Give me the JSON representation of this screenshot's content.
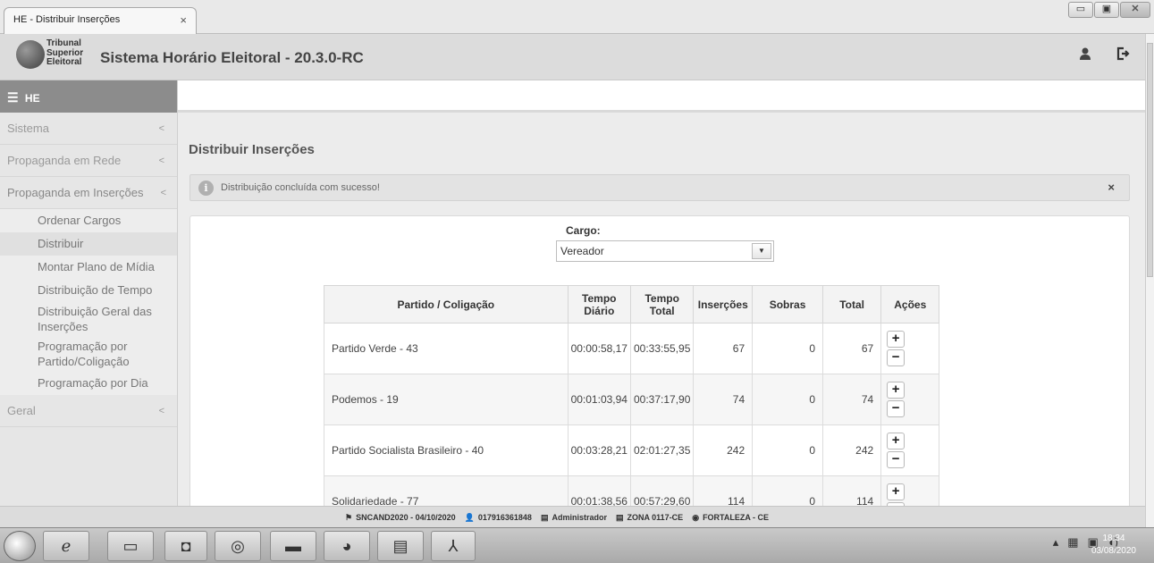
{
  "browser": {
    "tab_title": "HE - Distribuir Inserções",
    "tab_close": "×",
    "window_buttons": [
      "▭",
      "▣",
      "✕"
    ]
  },
  "header": {
    "logo_lines": [
      "Tribunal",
      "Superior",
      "Eleitoral"
    ],
    "title": "Sistema Horário Eleitoral - 20.3.0-RC",
    "user_icon": "user-icon",
    "logout_icon": "logout-icon"
  },
  "sidebar": {
    "toggle_label": "HE",
    "menu": [
      {
        "label": "Sistema",
        "chevron": "<"
      },
      {
        "label": "Propaganda em Rede",
        "chevron": "<"
      },
      {
        "label": "Propaganda em Inserções",
        "chevron": "<"
      }
    ],
    "submenu": [
      "Ordenar Cargos",
      "Distribuir",
      "Montar Plano de Mídia",
      "Distribuição de Tempo",
      "Distribuição Geral das Inserções",
      "Programação por Partido/Coligação",
      "Programação por Dia"
    ],
    "bottom_item": {
      "label": "Geral",
      "chevron": "<"
    }
  },
  "main": {
    "page_title": "Distribuir Inserções",
    "alert": {
      "message": "Distribuição concluída com sucesso!",
      "close": "×"
    },
    "cargo": {
      "label": "Cargo:",
      "value": "Vereador"
    },
    "table": {
      "headers": [
        "Partido / Coligação",
        "Tempo Diário",
        "Tempo Total",
        "Inserções",
        "Sobras",
        "Total",
        "Ações"
      ],
      "rows": [
        {
          "partido": "Partido Verde - 43",
          "diario": "00:00:58,17",
          "total_tempo": "00:33:55,95",
          "insercoes": "67",
          "sobras": "0",
          "total": "67"
        },
        {
          "partido": "Podemos - 19",
          "diario": "00:01:03,94",
          "total_tempo": "00:37:17,90",
          "insercoes": "74",
          "sobras": "0",
          "total": "74"
        },
        {
          "partido": "Partido Socialista Brasileiro - 40",
          "diario": "00:03:28,21",
          "total_tempo": "02:01:27,35",
          "insercoes": "242",
          "sobras": "0",
          "total": "242"
        },
        {
          "partido": "Solidariedade - 77",
          "diario": "00:01:38,56",
          "total_tempo": "00:57:29,60",
          "insercoes": "114",
          "sobras": "0",
          "total": "114"
        }
      ],
      "plus": "+",
      "minus": "−"
    }
  },
  "status_bar": {
    "items": [
      {
        "icon": "flag-icon",
        "glyph": "⚑",
        "text": "SNCAND2020 - 04/10/2020"
      },
      {
        "icon": "user-icon",
        "glyph": "👤",
        "text": "017916361848"
      },
      {
        "icon": "id-card-icon",
        "glyph": "▤",
        "text": "Administrador"
      },
      {
        "icon": "id-card-icon",
        "glyph": "▤",
        "text": "ZONA 0117-CE"
      },
      {
        "icon": "globe-icon",
        "glyph": "◉",
        "text": "FORTALEZA  -  CE"
      }
    ]
  },
  "taskbar": {
    "clock_time": "18:34",
    "clock_date": "03/08/2020"
  }
}
